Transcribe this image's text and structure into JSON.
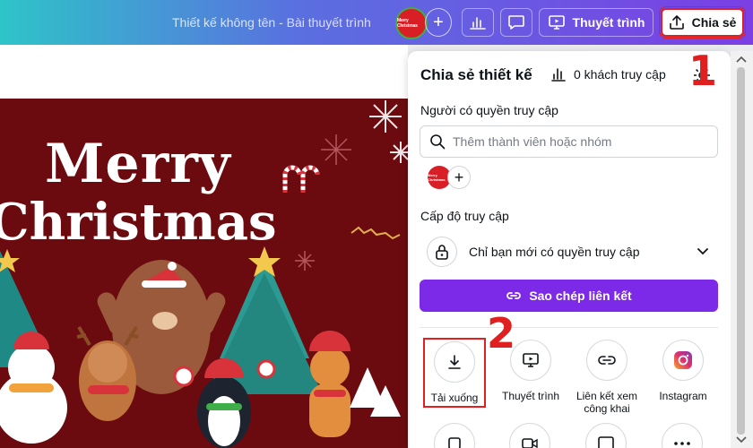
{
  "topbar": {
    "doc_title": "Thiết kế không tên - Bài thuyết trình",
    "avatar_text": "Merry Christmas",
    "plus_label": "+",
    "present_label": "Thuyết trình",
    "share_label": "Chia sẻ"
  },
  "design": {
    "line1": "Merry",
    "line2": "Christmas"
  },
  "panel": {
    "title": "Chia sẻ thiết kế",
    "visitors": "0 khách truy cập",
    "people_label": "Người có quyền truy cập",
    "search_placeholder": "Thêm thành viên hoặc nhóm",
    "access_level_label": "Cấp độ truy cập",
    "access_value": "Chỉ bạn mới có quyền truy cập",
    "copy_link_label": "Sao chép liên kết",
    "actions": [
      {
        "label": "Tải xuống",
        "icon": "download-icon"
      },
      {
        "label": "Thuyết trình",
        "icon": "present-icon"
      },
      {
        "label": "Liên kết xem công khai",
        "icon": "link-icon"
      },
      {
        "label": "Instagram",
        "icon": "instagram-icon"
      }
    ]
  },
  "annotations": {
    "one": "1",
    "two": "2"
  },
  "colors": {
    "accent": "#7d2ae8",
    "annotation": "#e02020",
    "design_bg": "#6b0b10"
  }
}
